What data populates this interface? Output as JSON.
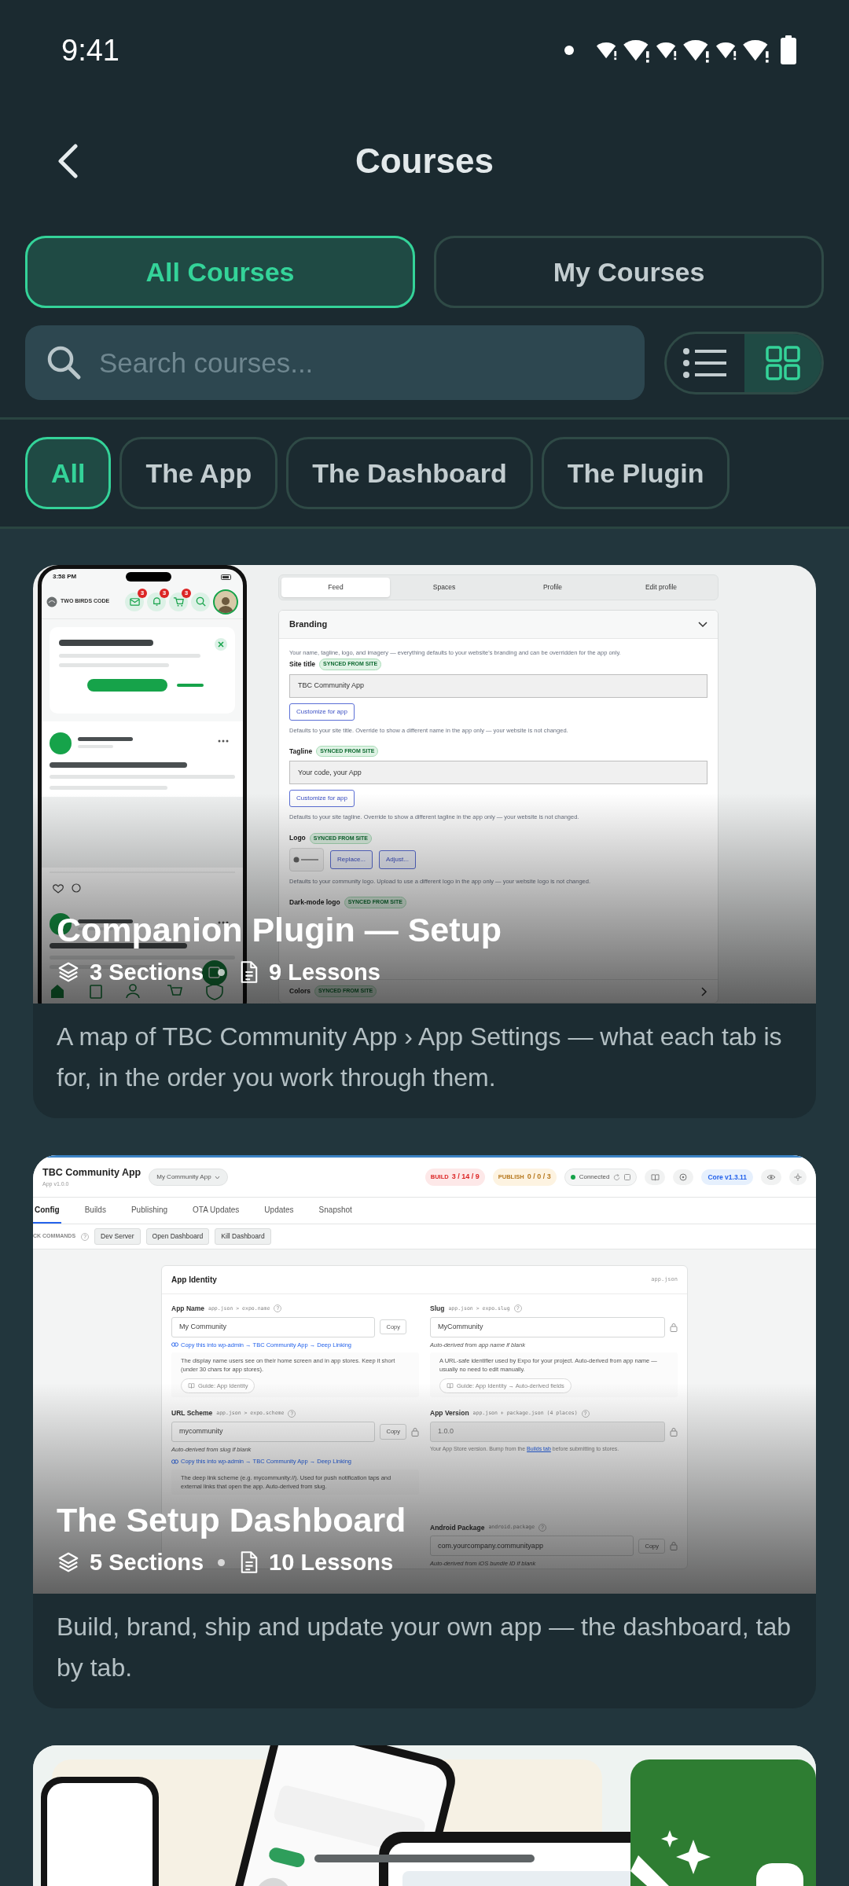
{
  "status_bar": {
    "time": "9:41"
  },
  "header": {
    "title": "Courses"
  },
  "tabs": [
    {
      "label": "All Courses",
      "selected": true
    },
    {
      "label": "My Courses",
      "selected": false
    }
  ],
  "search": {
    "placeholder": "Search courses..."
  },
  "view_toggle": [
    {
      "kind": "list",
      "selected": false
    },
    {
      "kind": "grid",
      "selected": true
    }
  ],
  "filters": [
    {
      "label": "All",
      "selected": true
    },
    {
      "label": "The App",
      "selected": false
    },
    {
      "label": "The Dashboard",
      "selected": false
    },
    {
      "label": "The Plugin",
      "selected": false
    }
  ],
  "courses": [
    {
      "title": "Companion Plugin — Setup",
      "sections": "3 Sections",
      "lessons": "9 Lessons",
      "description": "A map of TBC Community App › App Settings — what each tab is for, in the order you work through them.",
      "thumbnail": {
        "kind": "plugin_settings",
        "phone": {
          "time": "3:58 PM",
          "brand": "TWO BIRDS CODE",
          "header_icons": [
            {
              "kind": "mail",
              "badge": "3"
            },
            {
              "kind": "bell",
              "badge": "3"
            },
            {
              "kind": "cart",
              "badge": "3"
            },
            {
              "kind": "search"
            }
          ]
        },
        "tabs": [
          {
            "label": "Feed",
            "selected": true
          },
          {
            "label": "Spaces",
            "selected": false
          },
          {
            "label": "Profile",
            "selected": false
          },
          {
            "label": "Edit profile",
            "selected": false
          }
        ],
        "section": "Branding",
        "intro": "Your name, tagline, logo, and imagery — everything defaults to your website's branding and can be overridden for the app only.",
        "fields": [
          {
            "kind": "text",
            "label": "Site title",
            "badge": "SYNCED FROM SITE",
            "value": "TBC Community App",
            "button": "Customize for app",
            "help": "Defaults to your site title. Override to show a different name in the app only — your website is not changed."
          },
          {
            "kind": "text",
            "label": "Tagline",
            "badge": "SYNCED FROM SITE",
            "value": "Your code, your App",
            "button": "Customize for app",
            "help": "Defaults to your site tagline. Override to show a different tagline in the app only — your website is not changed."
          },
          {
            "kind": "logo",
            "label": "Logo",
            "badge": "SYNCED FROM SITE",
            "buttons": [
              "Replace...",
              "Adjust..."
            ],
            "help": "Defaults to your community logo. Upload to use a different logo in the app only — your website logo is not changed."
          },
          {
            "kind": "covered",
            "label": "Dark-mode logo",
            "badge": "SYNCED FROM SITE"
          }
        ],
        "footer_section": {
          "label": "Colors",
          "badge": "SYNCED FROM SITE"
        }
      }
    },
    {
      "title": "The Setup Dashboard",
      "sections": "5 Sections",
      "lessons": "10 Lessons",
      "description": "Build, brand, ship and update your own app — the dashboard, tab by tab.",
      "thumbnail": {
        "kind": "dashboard",
        "app": {
          "name": "TBC Community App",
          "version": "App v1.0.0"
        },
        "app_select": "My Community App",
        "pills": [
          {
            "kind": "build",
            "label": "BUILD",
            "value": "3 / 14 / 9"
          },
          {
            "kind": "publish",
            "label": "PUBLISH",
            "value": "0 / 0 / 3"
          }
        ],
        "connection": "Connected",
        "core": "Core v1.3.11",
        "tabs": [
          {
            "label": "Config",
            "selected": true
          },
          {
            "label": "Builds",
            "selected": false
          },
          {
            "label": "Publishing",
            "selected": false
          },
          {
            "label": "OTA Updates",
            "selected": false
          },
          {
            "label": "Updates",
            "selected": false
          },
          {
            "label": "Snapshot",
            "selected": false
          }
        ],
        "commands_label": "CK COMMANDS",
        "commands_hint": "?",
        "commands": [
          "Dev Server",
          "Open Dashboard",
          "Kill Dashboard"
        ],
        "panel": {
          "title": "App Identity",
          "file": "app.json",
          "columns": [
            [
              {
                "label": "App Name",
                "path": "app.json > expo.name",
                "hint": "?",
                "value": "My Community",
                "copy": "Copy",
                "locked": false,
                "disabled": false,
                "link": "Copy this into wp-admin → TBC Community App → Deep Linking",
                "help": "The display name users see on their home screen and in app stores. Keep it short (under 30 chars for app stores).",
                "guide": "Guide: App Identity"
              },
              {
                "label": "URL Scheme",
                "path": "app.json > expo.scheme",
                "hint": "?",
                "value": "mycommunity",
                "copy": "Copy",
                "locked": true,
                "disabled": false,
                "note": "Auto-derived from slug if blank",
                "link": "Copy this into wp-admin → TBC Community App → Deep Linking",
                "help": "The deep link scheme (e.g. mycommunity://). Used for push notification taps and external links that open the app. Auto-derived from slug."
              }
            ],
            [
              {
                "label": "Slug",
                "path": "app.json > expo.slug",
                "hint": "?",
                "value": "MyCommunity",
                "locked": true,
                "disabled": false,
                "note": "Auto-derived from app name if blank",
                "help": "A URL-safe identifier used by Expo for your project. Auto-derived from app name — usually no need to edit manually.",
                "guide": "Guide: App Identity → Auto-derived fields"
              },
              {
                "label": "App Version",
                "path": "app.json + package.json (4 places)",
                "hint": "?",
                "value": "1.0.0",
                "locked": true,
                "disabled": true,
                "help_parts": {
                  "before": "Your App Store version. Bump from the ",
                  "link": "Builds tab",
                  "after": " before submitting to stores."
                }
              },
              {
                "label": "Android Package",
                "path": "android.package",
                "hint": "?",
                "value": "com.yourcompany.communityapp",
                "copy": "Copy",
                "locked": true,
                "disabled": false,
                "note": "Auto-derived from iOS bundle ID if blank"
              }
            ]
          ]
        }
      }
    },
    {
      "thumbnail": {
        "kind": "picture"
      }
    }
  ]
}
